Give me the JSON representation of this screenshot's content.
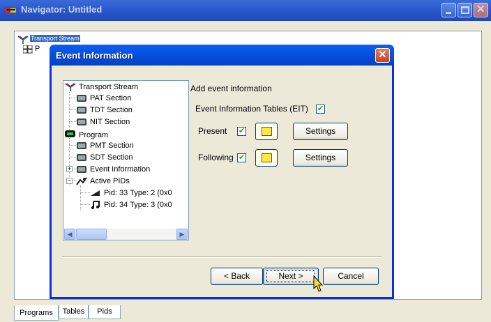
{
  "window": {
    "title": "Navigator: Untitled"
  },
  "main_tree": {
    "root_label": "Transport Stream",
    "child_label": "P"
  },
  "bottom_tabs": [
    {
      "label": "Programs"
    },
    {
      "label": "Tables"
    },
    {
      "label": "Pids"
    }
  ],
  "dialog": {
    "title": "Event Information",
    "tree_items": [
      {
        "label": "Transport Stream",
        "icon": "transport-stream-icon"
      },
      {
        "label": "PAT Section",
        "icon": "section-icon"
      },
      {
        "label": "TDT Section",
        "icon": "section-icon"
      },
      {
        "label": "NIT Section",
        "icon": "section-icon"
      },
      {
        "label": "Program",
        "icon": "program-icon"
      },
      {
        "label": "PMT Section",
        "icon": "section-icon"
      },
      {
        "label": "SDT Section",
        "icon": "section-icon"
      },
      {
        "label": "Event Information",
        "icon": "section-icon"
      },
      {
        "label": "Active PIDs",
        "icon": "pids-icon"
      },
      {
        "label": "Pid: 33 Type: 2 (0x0",
        "icon": "video-icon"
      },
      {
        "label": "Pid: 34 Type: 3 (0x0",
        "icon": "audio-icon"
      }
    ],
    "heading": "Add event information",
    "eit_label": "Event Information Tables (EIT)",
    "eit_checked": true,
    "present_label": "Present",
    "present_checked": true,
    "following_label": "Following",
    "following_checked": true,
    "settings_label": "Settings",
    "back_label": "< Back",
    "next_label": "Next >",
    "cancel_label": "Cancel"
  }
}
